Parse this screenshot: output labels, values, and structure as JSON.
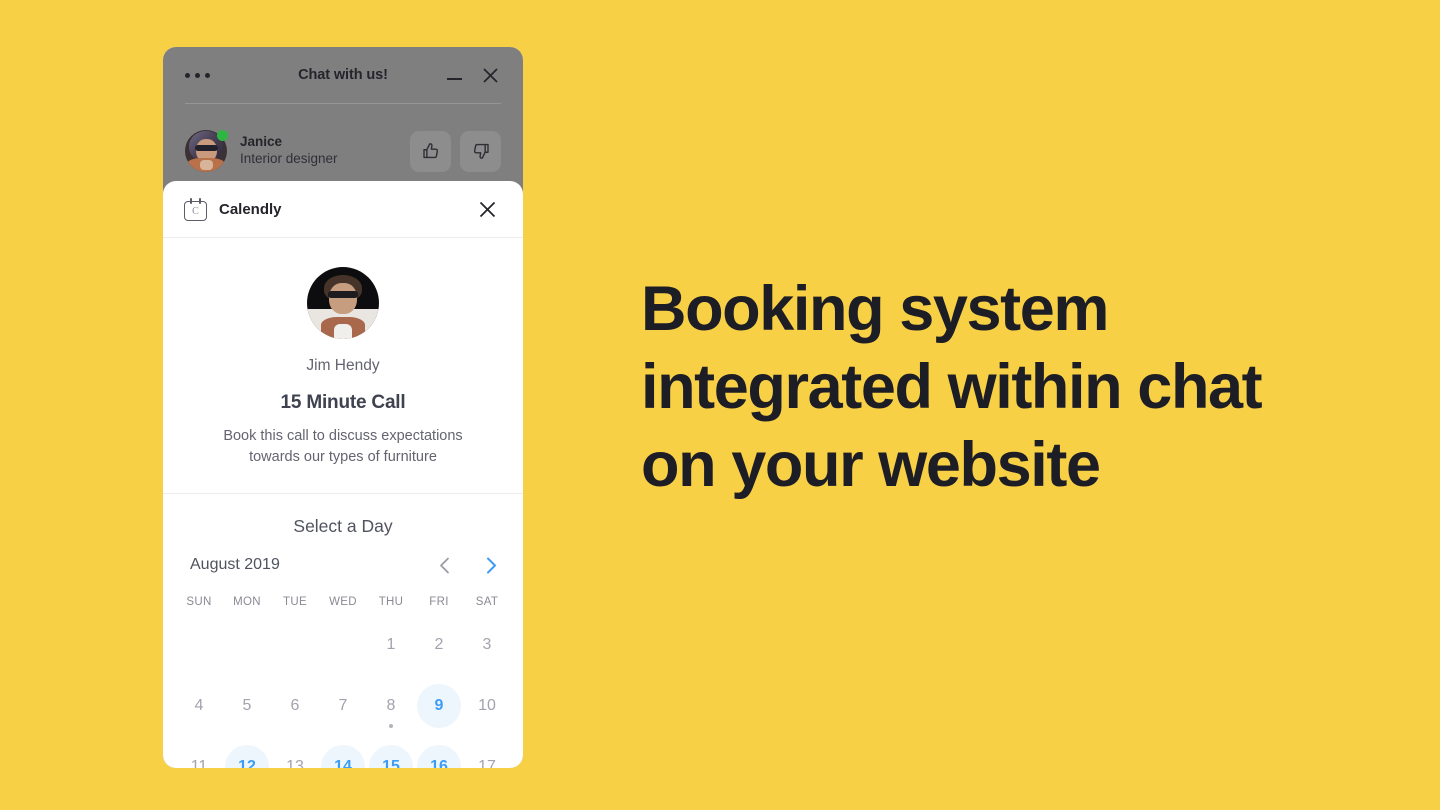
{
  "page": {
    "background_color": "#f7d046",
    "headline": "Booking system integrated within chat on your website",
    "headline_color": "#1d1d26"
  },
  "chat": {
    "menu_icon": "more-horizontal-icon",
    "title": "Chat with us!",
    "minimize_icon": "minimize-icon",
    "close_icon": "close-icon",
    "agent": {
      "name": "Janice",
      "role": "Interior designer",
      "avatar_icon": "avatar",
      "status": "online",
      "status_color": "#2db742"
    },
    "rating": {
      "thumbs_up_icon": "thumbs-up-icon",
      "thumbs_down_icon": "thumbs-down-icon"
    }
  },
  "calendly": {
    "brand": "Calendly",
    "logo_icon": "calendar-icon",
    "logo_letter": "C",
    "close_icon": "close-icon",
    "host_name": "Jim Hendy",
    "event_title": "15 Minute Call",
    "event_description": "Book this call to discuss expectations towards our types of furniture",
    "select_day_label": "Select a Day",
    "month_label": "August 2019",
    "prev_icon": "chevron-left-icon",
    "next_icon": "chevron-right-icon",
    "prev_enabled": false,
    "next_enabled": true,
    "accent_color": "#3d9df5",
    "available_bg_color": "#edf6fd",
    "weekdays": [
      "SUN",
      "MON",
      "TUE",
      "WED",
      "THU",
      "FRI",
      "SAT"
    ],
    "weeks": [
      [
        {
          "label": "",
          "state": "empty"
        },
        {
          "label": "",
          "state": "empty"
        },
        {
          "label": "",
          "state": "empty"
        },
        {
          "label": "",
          "state": "empty"
        },
        {
          "label": "1",
          "state": "unavailable"
        },
        {
          "label": "2",
          "state": "unavailable"
        },
        {
          "label": "3",
          "state": "unavailable"
        }
      ],
      [
        {
          "label": "4",
          "state": "unavailable"
        },
        {
          "label": "5",
          "state": "unavailable"
        },
        {
          "label": "6",
          "state": "unavailable"
        },
        {
          "label": "7",
          "state": "unavailable"
        },
        {
          "label": "8",
          "state": "unavailable",
          "dot": true
        },
        {
          "label": "9",
          "state": "available"
        },
        {
          "label": "10",
          "state": "unavailable"
        }
      ],
      [
        {
          "label": "11",
          "state": "unavailable"
        },
        {
          "label": "12",
          "state": "available"
        },
        {
          "label": "13",
          "state": "unavailable"
        },
        {
          "label": "14",
          "state": "available"
        },
        {
          "label": "15",
          "state": "available"
        },
        {
          "label": "16",
          "state": "available"
        },
        {
          "label": "17",
          "state": "unavailable"
        }
      ]
    ]
  }
}
